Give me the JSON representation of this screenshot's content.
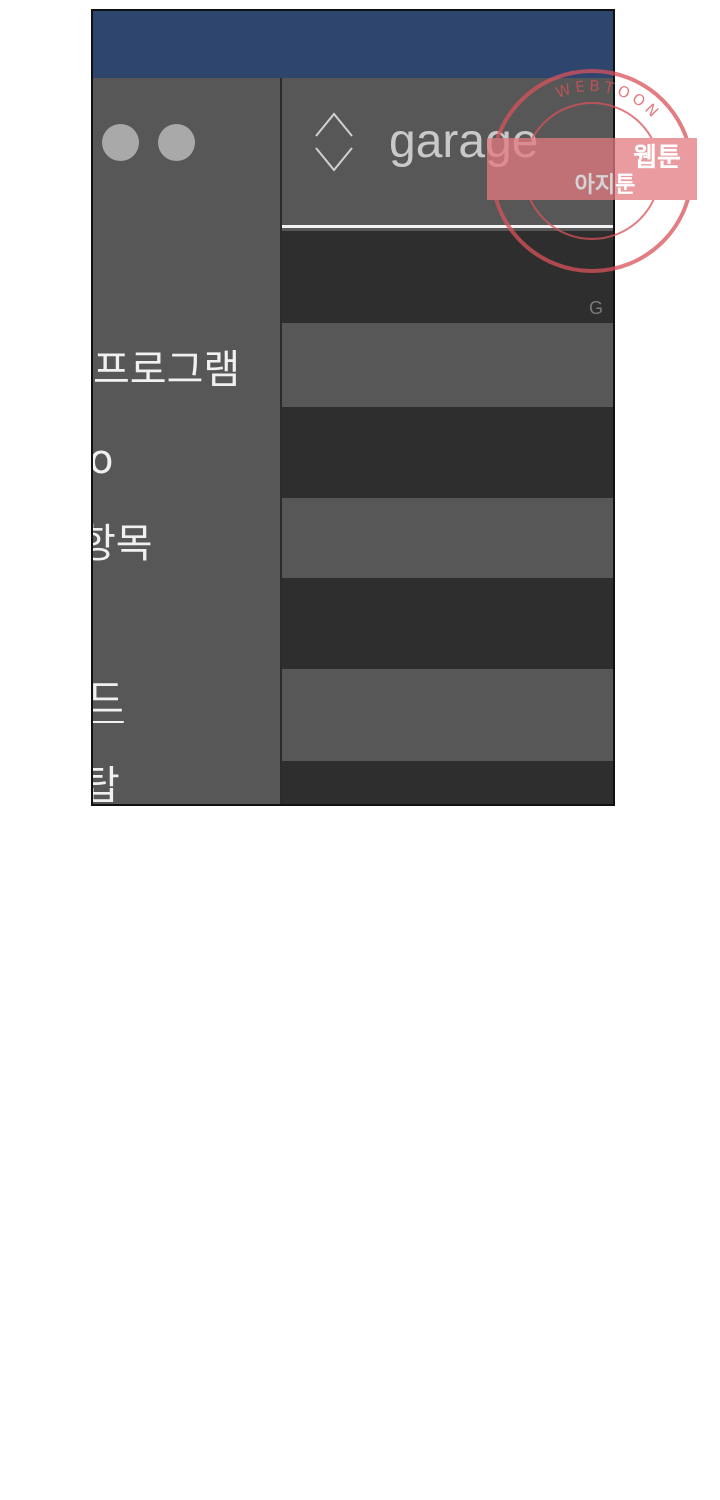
{
  "window": {
    "titlebar_color": "#2e466e",
    "control_dots": [
      "dot",
      "dot"
    ]
  },
  "sidebar": {
    "items": [
      {
        "label": "프로그램",
        "underlined": false
      },
      {
        "label": "o",
        "underlined": false
      },
      {
        "label": "항목",
        "underlined": false
      },
      {
        "label": "드",
        "underlined": true
      },
      {
        "label": "탑",
        "underlined": false
      }
    ]
  },
  "main": {
    "header_title": "garage",
    "sort_icon": "sort-updown-icon",
    "rows": [
      {
        "shade": "dark",
        "label": "G"
      },
      {
        "shade": "light",
        "label": ""
      },
      {
        "shade": "dark",
        "label": ""
      },
      {
        "shade": "light",
        "label": ""
      },
      {
        "shade": "dark",
        "label": ""
      },
      {
        "shade": "light",
        "label": ""
      },
      {
        "shade": "dark",
        "label": ""
      }
    ]
  },
  "watermark": {
    "icon": "webtoon-stamp-icon",
    "ring_text": "WEBTOON",
    "main_text": "웹툰",
    "sub_text": "아지툰",
    "color": "#d9525a"
  }
}
